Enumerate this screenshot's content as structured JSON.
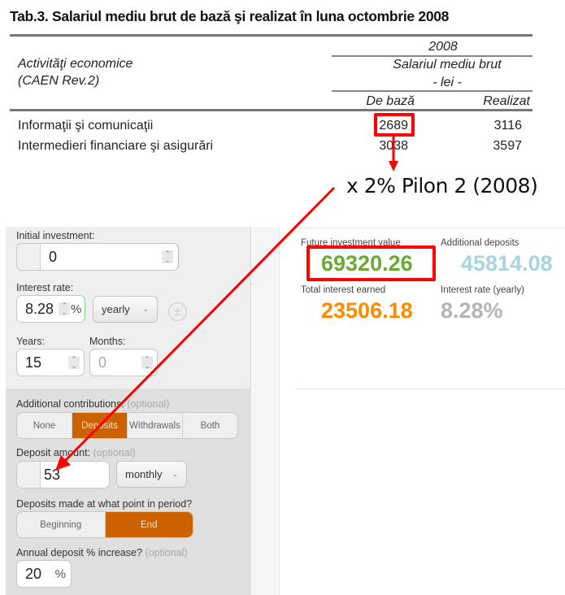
{
  "table": {
    "title": "Tab.3. Salariul mediu brut de bază şi realizat în luna octombrie 2008",
    "row_header": [
      "Activităţi economice",
      "(CAEN Rev.2)"
    ],
    "year": "2008",
    "group_header": "Salariul mediu brut",
    "unit": "- lei -",
    "columns": [
      "De bază",
      "Realizat"
    ],
    "rows": [
      {
        "label": "Informaţii şi comunicaţii",
        "values": [
          "2689",
          "3116"
        ]
      },
      {
        "label": "Intermedieri financiare şi asigurări",
        "values": [
          "3038",
          "3597"
        ]
      }
    ]
  },
  "annotation": {
    "text": "x 2% Pilon 2 (2008)",
    "color": "#ff0000"
  },
  "calculator": {
    "initial_investment": {
      "label": "Initial investment:",
      "value": "0"
    },
    "interest_rate": {
      "label": "Interest rate:",
      "value": "8.28",
      "unit": "%",
      "period": "yearly",
      "add_icon": "plus-minus-icon"
    },
    "years": {
      "label": "Years:",
      "value": "15"
    },
    "months": {
      "label": "Months:",
      "value": "0"
    },
    "contributions": {
      "label": "Additional contributions:",
      "optional": "(optional)",
      "options": [
        "None",
        "Deposits",
        "Withdrawals",
        "Both"
      ],
      "selected": "Deposits"
    },
    "deposit_amount": {
      "label": "Deposit amount:",
      "optional": "(optional)",
      "value": "53",
      "frequency": "monthly"
    },
    "deposit_timing": {
      "label": "Deposits made at what point in period?",
      "options": [
        "Beginning",
        "End"
      ],
      "selected": "End"
    },
    "annual_increase": {
      "label": "Annual deposit % increase?",
      "optional": "(optional)",
      "value": "20",
      "unit": "%"
    },
    "accent": "#cc6100"
  },
  "results": {
    "future_value": {
      "label": "Future investment value",
      "value": "69320.26",
      "color": "#6aaa32"
    },
    "additional_deposits": {
      "label": "Additional deposits",
      "value": "45814.08",
      "color": "#a8d4e2"
    },
    "total_interest": {
      "label": "Total interest earned",
      "value": "23506.18",
      "color": "#ff8a00"
    },
    "interest_rate": {
      "label": "Interest rate (yearly)",
      "value": "8.28%",
      "color": "#b4b4b4"
    }
  }
}
